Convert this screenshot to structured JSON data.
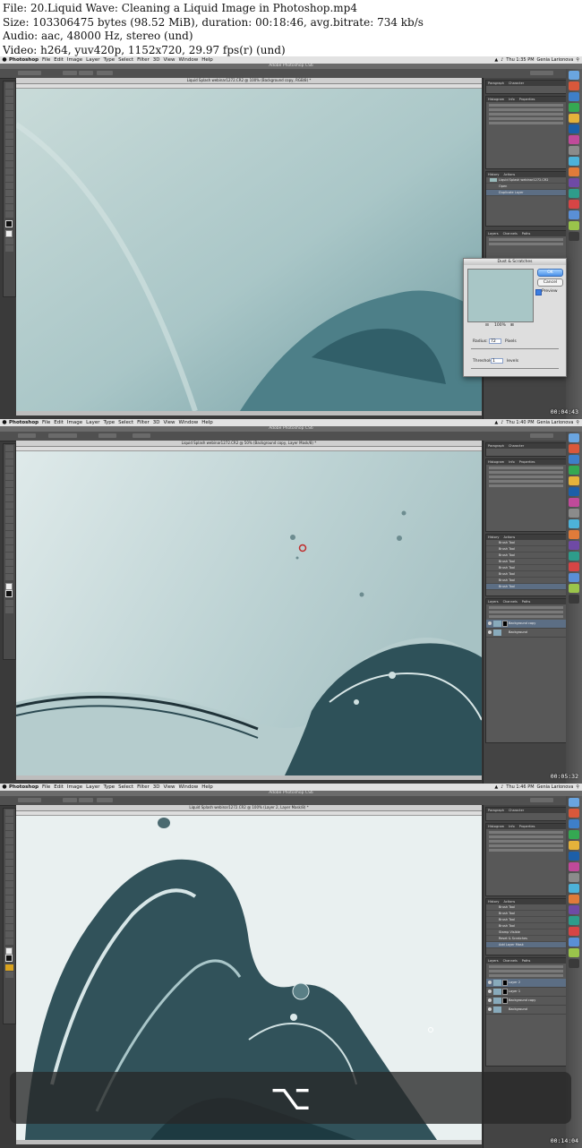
{
  "info": {
    "lines": [
      "File: 20.Liquid Wave: Cleaning a Liquid Image in Photoshop.mp4",
      "Size: 103306475 bytes (98.52 MiB), duration: 00:18:46, avg.bitrate: 734 kb/s",
      "Audio: aac, 48000 Hz, stereo (und)",
      "Video: h264, yuv420p, 1152x720, 29.97 fps(r) (und)"
    ]
  },
  "menubar": {
    "app": "Photoshop",
    "items": [
      "File",
      "Edit",
      "Image",
      "Layer",
      "Type",
      "Select",
      "Filter",
      "3D",
      "View",
      "Window",
      "Help"
    ],
    "user": "Genia Larionova"
  },
  "window_title": "Adobe Photoshop CS6",
  "frames": [
    {
      "clock": "Thu 1:35 PM",
      "doc_title": "Liquid Splash webinar1272.CR2 @ 100% (Background copy, RGB/8) *",
      "timestamp": "00:04:43",
      "history": [
        "Liquid Splash webinar1272.CR2",
        "Open",
        "Duplicate Layer"
      ],
      "dialog": {
        "title": "Dust & Scratches",
        "ok": "OK",
        "cancel": "Cancel",
        "preview": "Preview",
        "zoom": "100%",
        "radius_label": "Radius:",
        "radius": "72",
        "radius_unit": "Pixels",
        "threshold_label": "Threshold:",
        "threshold": "1",
        "threshold_unit": "levels"
      }
    },
    {
      "clock": "Thu 1:40 PM",
      "doc_title": "Liquid Splash webinar1272.CR2 @ 50% (Background copy, Layer Mask/8) *",
      "timestamp": "00:05:32",
      "history": [
        "Brush Tool",
        "Brush Tool",
        "Brush Tool",
        "Brush Tool",
        "Brush Tool",
        "Brush Tool",
        "Brush Tool",
        "Brush Tool"
      ],
      "layers": [
        "Background copy",
        "Background"
      ]
    },
    {
      "clock": "Thu 1:46 PM",
      "doc_title": "Liquid Splash webinar1272.CR2 @ 100% (Layer 2, Layer Mask/8) *",
      "timestamp": "00:14:04",
      "history": [
        "Brush Tool",
        "Brush Tool",
        "Brush Tool",
        "Brush Tool",
        "Stamp Visible",
        "Reset & Scratches",
        "Add Layer Mask"
      ],
      "layers": [
        "Layer 2",
        "Layer 1",
        "Background copy",
        "Background"
      ],
      "shortcut_key": "⌥"
    }
  ],
  "panel_tabs": {
    "adjust": [
      "Histogram",
      "Info",
      "Properties"
    ],
    "history": [
      "History",
      "Actions"
    ],
    "layers": [
      "Layers",
      "Channels",
      "Paths"
    ],
    "top": [
      "Paragraph",
      "Character"
    ]
  }
}
